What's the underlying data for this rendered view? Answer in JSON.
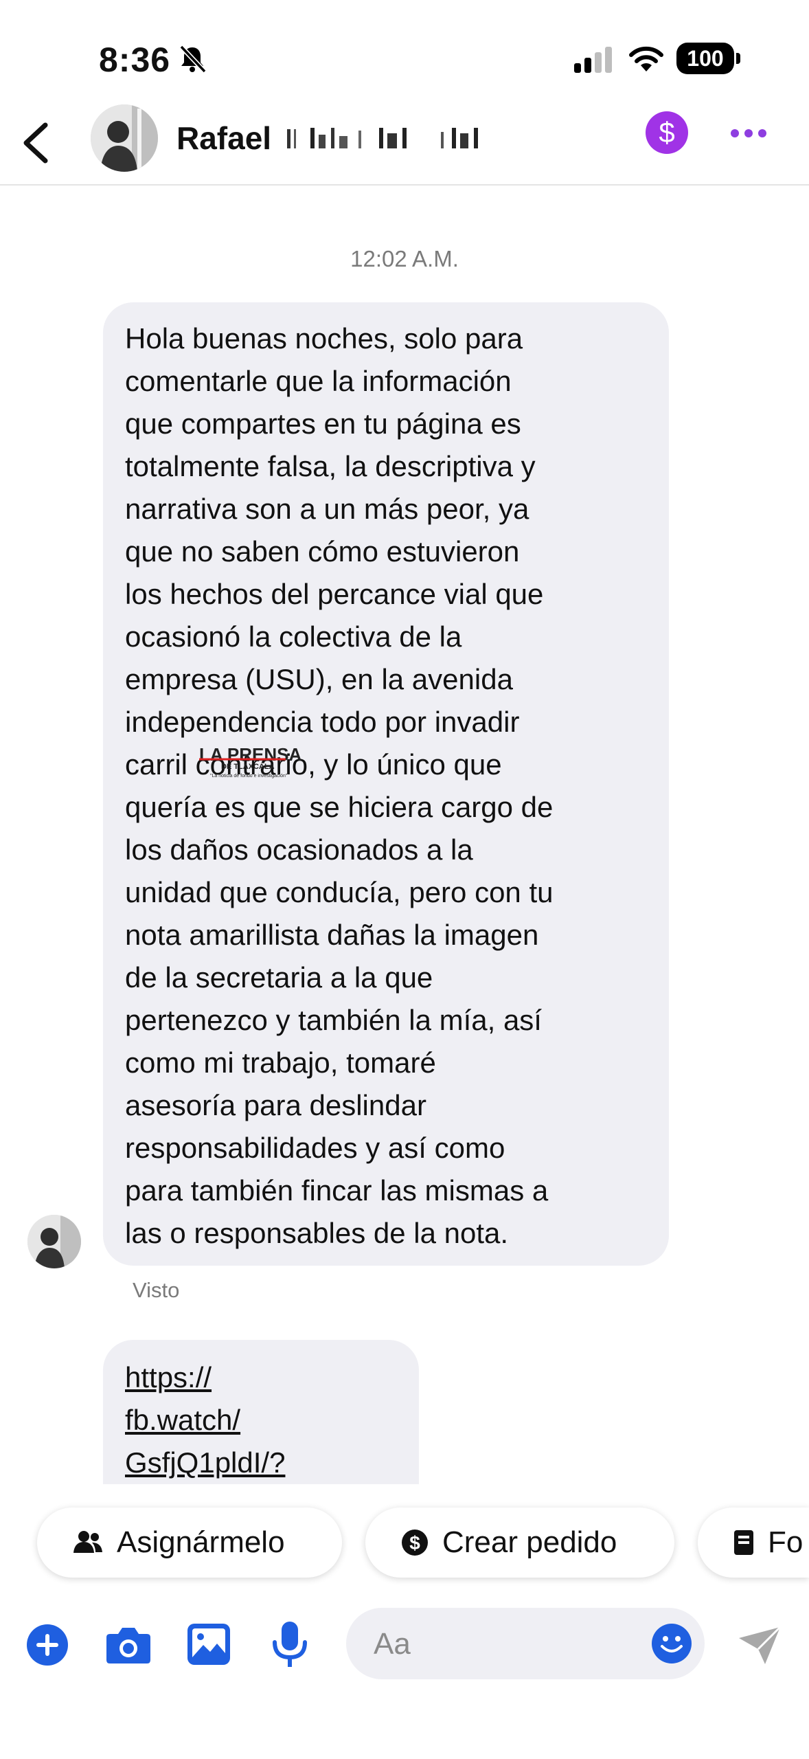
{
  "status_bar": {
    "time": "8:36",
    "battery": "100"
  },
  "header": {
    "contact_name": "Rafael",
    "back_label": ""
  },
  "conversation": {
    "timestamp": "12:02 A.M.",
    "message_text": "Hola buenas noches, solo para\ncomentarle que la información\nque compartes en tu página es\ntotalmente falsa, la descriptiva y\nnarrativa son a un más peor, ya\nque no saben cómo estuvieron\nlos hechos del percance vial que\nocasionó la colectiva de la\nempresa (USU), en la avenida\nindependencia todo por invadir\ncarril contrario, y lo único que\nquería es que se hiciera cargo de\nlos daños ocasionados a la\nunidad que conducía, pero con tu\nnota amarillista dañas la imagen\nde la secretaria a la que\npertenezco y también la mía, así\ncomo mi trabajo, tomaré\nasesoría para deslindar\nresponsabilidades y así como\npara también fincar las mismas a\nlas o responsables de la nota.",
    "seen_label": "Visto",
    "link_text": "https://\nfb.watch/\nGsfjQ1pldI/?"
  },
  "watermark": {
    "brand": "LA PRENSA",
    "region": "DE TLAXCALA",
    "tagline": "\"La noticia de fondo e investigación\""
  },
  "quick_replies": [
    {
      "label": "Asignármelo",
      "icon": "people-icon"
    },
    {
      "label": "Crear pedido",
      "icon": "dollar-circle-icon"
    },
    {
      "label": "Fo",
      "icon": "document-icon"
    }
  ],
  "composer": {
    "placeholder": "Aa"
  },
  "colors": {
    "accent_blue": "#1f5fe0",
    "payment_purple": "#a033e6",
    "bubble_gray": "#efeff4"
  }
}
